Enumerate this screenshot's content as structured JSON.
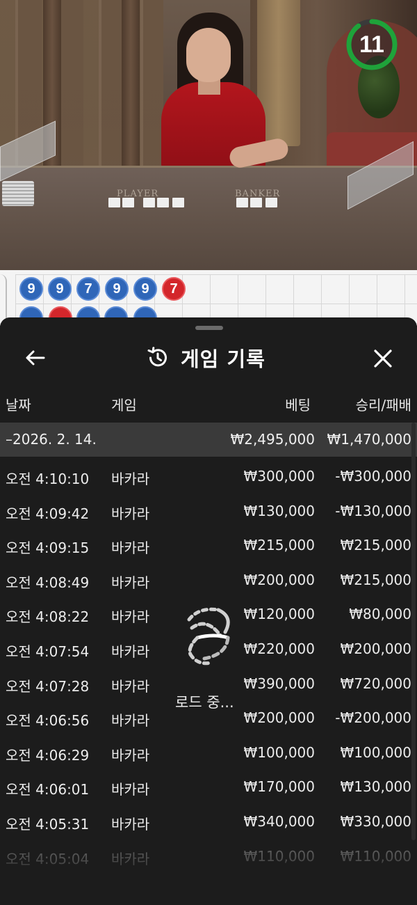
{
  "video": {
    "table_labels": {
      "player": "PLAYER",
      "banker": "BANKER"
    },
    "timer": {
      "value": "11",
      "progress": 0.9,
      "color": "#1fa33a"
    }
  },
  "roadmap": {
    "beads_row1": [
      {
        "value": "9",
        "side": "player"
      },
      {
        "value": "9",
        "side": "player"
      },
      {
        "value": "7",
        "side": "player"
      },
      {
        "value": "9",
        "side": "player"
      },
      {
        "value": "9",
        "side": "player"
      },
      {
        "value": "7",
        "side": "banker"
      }
    ],
    "colors": {
      "player": "#2f66b8",
      "banker": "#d3262b"
    }
  },
  "sheet": {
    "title": "게임 기록",
    "icons": {
      "back": "arrow-left-icon",
      "history": "history-icon",
      "close": "close-icon"
    },
    "columns": {
      "date": "날짜",
      "game": "게임",
      "bet": "베팅",
      "win_loss": "승리/패배"
    },
    "day": {
      "date": "–2026. 2. 14.",
      "bet": "₩2,495,000",
      "win_loss": "₩1,470,000"
    },
    "rows": [
      {
        "time": "오전 4:10:10",
        "game": "바카라",
        "bet": "₩300,000",
        "win_loss": "-₩300,000"
      },
      {
        "time": "오전 4:09:42",
        "game": "바카라",
        "bet": "₩130,000",
        "win_loss": "-₩130,000"
      },
      {
        "time": "오전 4:09:15",
        "game": "바카라",
        "bet": "₩215,000",
        "win_loss": "₩215,000"
      },
      {
        "time": "오전 4:08:49",
        "game": "바카라",
        "bet": "₩200,000",
        "win_loss": "₩215,000"
      },
      {
        "time": "오전 4:08:22",
        "game": "바카라",
        "bet": "₩120,000",
        "win_loss": "₩80,000"
      },
      {
        "time": "오전 4:07:54",
        "game": "바카라",
        "bet": "₩220,000",
        "win_loss": "₩200,000"
      },
      {
        "time": "오전 4:07:28",
        "game": "바카라",
        "bet": "₩390,000",
        "win_loss": "₩720,000"
      },
      {
        "time": "오전 4:06:56",
        "game": "바카라",
        "bet": "₩200,000",
        "win_loss": "-₩200,000"
      },
      {
        "time": "오전 4:06:29",
        "game": "바카라",
        "bet": "₩100,000",
        "win_loss": "₩100,000"
      },
      {
        "time": "오전 4:06:01",
        "game": "바카라",
        "bet": "₩170,000",
        "win_loss": "₩130,000"
      },
      {
        "time": "오전 4:05:31",
        "game": "바카라",
        "bet": "₩340,000",
        "win_loss": "₩330,000"
      },
      {
        "time": "오전 4:05:04",
        "game": "바카라",
        "bet": "₩110,000",
        "win_loss": "₩110,000"
      }
    ],
    "loading_text": "로드 중..."
  }
}
